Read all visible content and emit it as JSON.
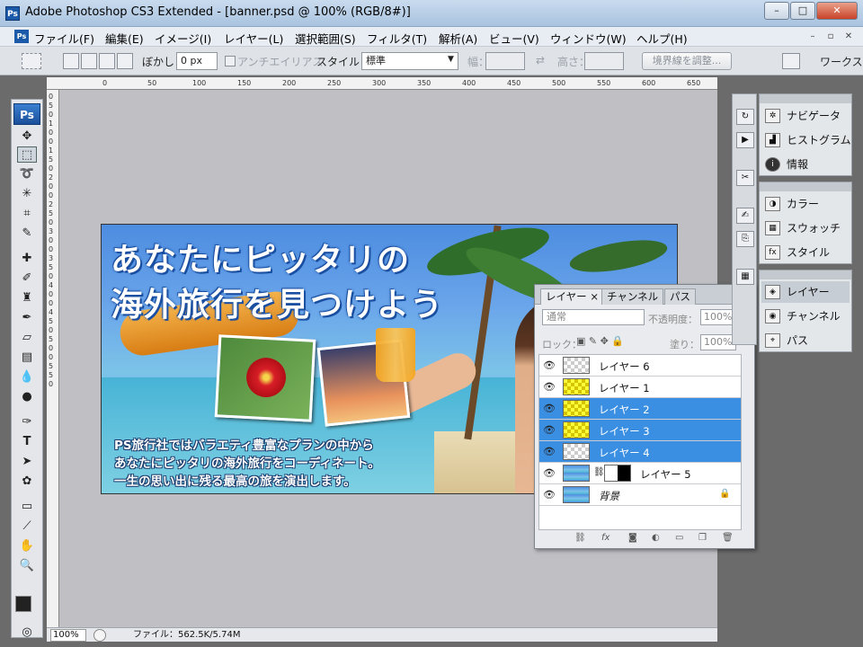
{
  "window": {
    "app_icon": "Ps",
    "title": "Adobe Photoshop CS3 Extended - [banner.psd @ 100% (RGB/8#)]",
    "minimize": "–",
    "maximize": "□",
    "close": "✕"
  },
  "menu": {
    "logo": "Ps",
    "items": [
      "ファイル(F)",
      "編集(E)",
      "イメージ(I)",
      "レイヤー(L)",
      "選択範囲(S)",
      "フィルタ(T)",
      "解析(A)",
      "ビュー(V)",
      "ウィンドウ(W)",
      "ヘルプ(H)"
    ],
    "doc_minimize": "–",
    "doc_restore": "▫",
    "doc_close": "✕"
  },
  "options": {
    "feather_label": "ぼかし：",
    "feather_value": "0 px",
    "antialias_label": "アンチエイリアス",
    "style_label": "スタイル：",
    "style_value": "標準",
    "width_label": "幅：",
    "height_label": "高さ：",
    "refine_button": "境界線を調整...",
    "workspace_label": "ワークス"
  },
  "toolbox": {
    "logo": "Ps",
    "tools": [
      "move",
      "marquee",
      "lasso",
      "magic-wand",
      "crop",
      "slice",
      "healing",
      "brush",
      "stamp",
      "history-brush",
      "eraser",
      "gradient",
      "blur",
      "dodge",
      "pen",
      "type",
      "path-select",
      "shape",
      "notes",
      "eyedropper",
      "hand",
      "zoom"
    ]
  },
  "rulers": {
    "top": [
      "0",
      "50",
      "100",
      "150",
      "200",
      "250",
      "300",
      "350",
      "400",
      "450",
      "500",
      "550",
      "600",
      "650"
    ],
    "left": [
      "0",
      "5",
      "0",
      "1",
      "0",
      "0",
      "1",
      "5",
      "0",
      "2",
      "0",
      "0",
      "2",
      "5",
      "0",
      "3",
      "0",
      "0",
      "3",
      "5",
      "0",
      "4",
      "0",
      "0",
      "4",
      "5",
      "0",
      "5",
      "0",
      "0",
      "5",
      "5",
      "0"
    ]
  },
  "banner": {
    "headline_1": "あなたにピッタリの",
    "headline_2": "海外旅行を見つけよう",
    "body_1": "PS旅行社ではバラエティ豊富なプランの中から",
    "body_2": "あなたにピッタリの海外旅行をコーディネート。",
    "body_3": "一生の思い出に残る最高の旅を演出します。"
  },
  "status": {
    "zoom": "100%",
    "file_info": "ファイル：562.5K/5.74M"
  },
  "layers_panel": {
    "tabs": [
      "レイヤー",
      "チャンネル",
      "パス"
    ],
    "tab_close": "×",
    "blend_mode": "通常",
    "opacity_label": "不透明度：",
    "opacity_value": "100%",
    "lock_label": "ロック：",
    "fill_label": "塗り：",
    "fill_value": "100%",
    "layers": [
      {
        "name": "レイヤー 6",
        "selected": false,
        "thumb": "transparent"
      },
      {
        "name": "レイヤー 1",
        "selected": false,
        "thumb": "yellow"
      },
      {
        "name": "レイヤー 2",
        "selected": true,
        "thumb": "yellow"
      },
      {
        "name": "レイヤー 3",
        "selected": true,
        "thumb": "yellow"
      },
      {
        "name": "レイヤー 4",
        "selected": true,
        "thumb": "transparent"
      },
      {
        "name": "レイヤー 5",
        "selected": false,
        "thumb": "image-mask"
      },
      {
        "name": "背景",
        "selected": false,
        "thumb": "image",
        "locked": true
      }
    ],
    "bottom_icons": [
      "link-icon",
      "fx-icon",
      "mask-icon",
      "adjustment-icon",
      "group-icon",
      "new-layer-icon",
      "trash-icon"
    ]
  },
  "right_dock": {
    "group1": [
      "ナビゲータ",
      "ヒストグラム",
      "情報"
    ],
    "group2": [
      "カラー",
      "スウォッチ",
      "スタイル"
    ],
    "group3": [
      "レイヤー",
      "チャンネル",
      "パス"
    ],
    "active": "レイヤー"
  },
  "colors": {
    "selection_blue": "#3b8fe3",
    "highlight_yellow": "#e6f000",
    "ps_blue": "#1b5aa8"
  }
}
